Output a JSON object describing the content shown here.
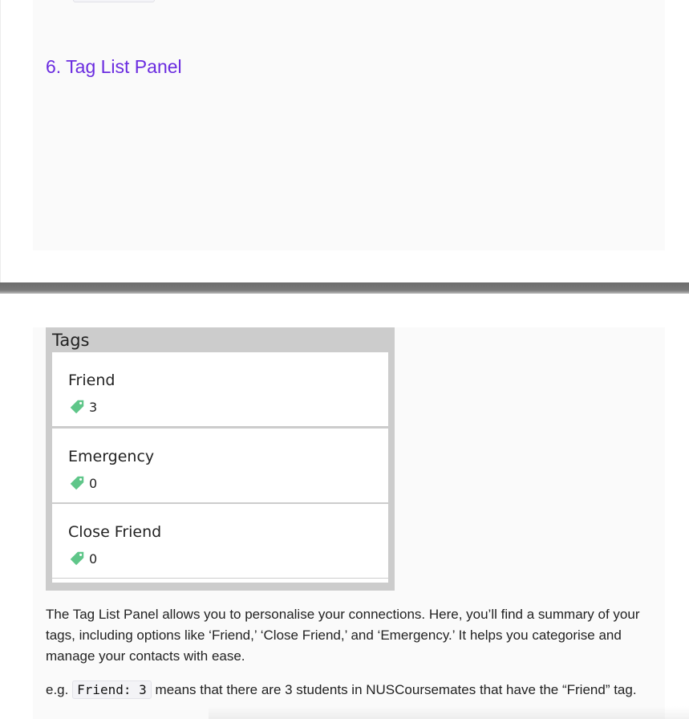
{
  "section": {
    "title": "6. Tag List Panel"
  },
  "tag_panel": {
    "title": "Tags",
    "tags": [
      {
        "name": "Friend",
        "count": "3"
      },
      {
        "name": "Emergency",
        "count": "0"
      },
      {
        "name": "Close Friend",
        "count": "0"
      }
    ],
    "icon": "tag-icon",
    "icon_color": "#5fc689"
  },
  "description": "The Tag List Panel allows you to personalise your connections. Here, you’ll find a summary of your tags, including options like ‘Friend,’ ‘Close Friend,’ and ‘Emergency.’ It helps you categorise and manage your contacts with ease.",
  "example": {
    "prefix": "e.g.",
    "code": "Friend: 3",
    "suffix": "means that there are 3 students in NUSCoursemates that have the “Friend” tag."
  }
}
